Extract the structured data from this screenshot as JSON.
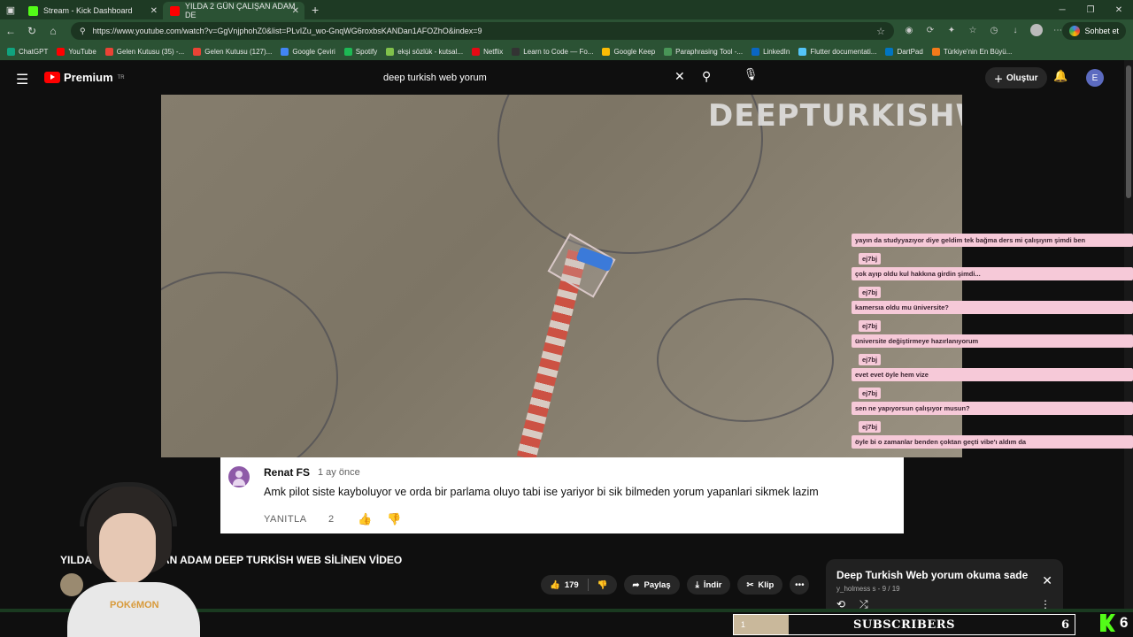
{
  "browser": {
    "tabs": [
      {
        "title": "Stream - Kick Dashboard",
        "fav_color": "#53fc18"
      },
      {
        "title": "YILDA 2 GÜN ÇALIŞAN ADAM DE",
        "fav_color": "#ff0000"
      }
    ],
    "url": "https://www.youtube.com/watch?v=GgVnjphohZ0&list=PLvIZu_wo-GnqWG6roxbsKANDan1AFOZhO&index=9",
    "chat_button": "Sohbet et",
    "bookmarks": [
      {
        "label": "ChatGPT",
        "color": "#10a37f"
      },
      {
        "label": "YouTube",
        "color": "#ff0000"
      },
      {
        "label": "Gelen Kutusu (35) -...",
        "color": "#ea4335"
      },
      {
        "label": "Gelen Kutusu (127)...",
        "color": "#ea4335"
      },
      {
        "label": "Google Çeviri",
        "color": "#4285f4"
      },
      {
        "label": "Spotify",
        "color": "#1db954"
      },
      {
        "label": "ekşi sözlük - kutsal...",
        "color": "#81c14b"
      },
      {
        "label": "Netflix",
        "color": "#e50914"
      },
      {
        "label": "Learn to Code — Fo...",
        "color": "#333333"
      },
      {
        "label": "Google Keep",
        "color": "#fbbc04"
      },
      {
        "label": "Paraphrasing Tool -...",
        "color": "#499557"
      },
      {
        "label": "LinkedIn",
        "color": "#0a66c2"
      },
      {
        "label": "Flutter documentati...",
        "color": "#54c5f8"
      },
      {
        "label": "DartPad",
        "color": "#0175c2"
      },
      {
        "label": "Türkiye'nin En Büyü...",
        "color": "#f27a1a"
      }
    ]
  },
  "youtube": {
    "logo_text": "Premium",
    "logo_region": "TR",
    "search_value": "deep turkish web yorum",
    "create_label": "Oluştur",
    "user_initial": "E"
  },
  "video": {
    "watermark": "DEEPTURKISHWEB",
    "title": "YILDA 2 GÜN ÇALIŞAN ADAM DEEP TURKİSH WEB SİLİNEN VİDEO",
    "likes": "179",
    "share_label": "Paylaş",
    "download_label": "İndir",
    "clip_label": "Klip"
  },
  "comment": {
    "author": "Renat FS",
    "time": "1 ay önce",
    "text": "Amk pilot siste kayboluyor ve orda bir parlama oluyo tabi ise yariyor bi sik bilmeden yorum yapanlari sikmek lazim",
    "reply_label": "YANITLA",
    "like_count": "2"
  },
  "chat": [
    {
      "user": "",
      "text": "yayın da studyyazıyor diye geldim tek bağma ders mi çalışıyım şimdi ben"
    },
    {
      "user": "ej7bj",
      "text": "çok ayıp oldu kul hakkına girdin şimdi..."
    },
    {
      "user": "ej7bj",
      "text": "kamersıa oldu mu üniversite?"
    },
    {
      "user": "ej7bj",
      "text": "üniversite değiştirmeye hazırlanıyorum"
    },
    {
      "user": "ej7bj",
      "text": "evet evet öyle hem vize"
    },
    {
      "user": "ej7bj",
      "text": "sen ne yapıyorsun çalışıyor musun?"
    },
    {
      "user": "ej7bj",
      "text": "öyle bi o zamanlar benden çoktan geçti vibe'ı aldım da"
    }
  ],
  "playlist": {
    "title": "Deep Turkish Web yorum okuma sade",
    "subtitle": "y_holmess s - 9 / 19"
  },
  "overlay": {
    "subs_label": "SUBSCRIBERS",
    "subs_count": "6",
    "subs_current": "1",
    "subs_progress": 0.16,
    "kick_count": "6",
    "shirt_text": "POKéMON"
  }
}
